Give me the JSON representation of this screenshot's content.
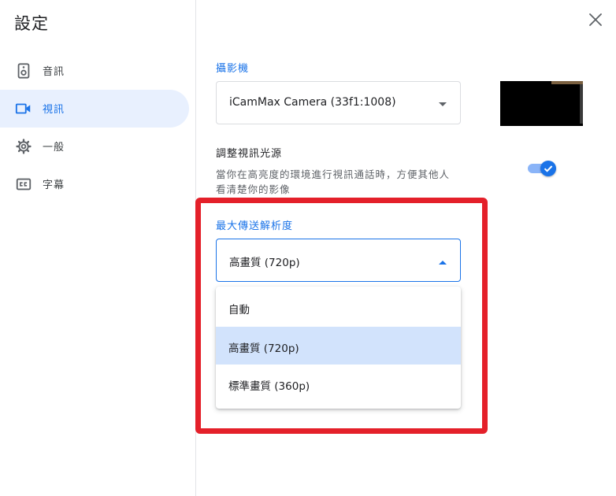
{
  "dialog": {
    "title": "設定",
    "close_icon": "close-icon"
  },
  "sidebar": {
    "items": [
      {
        "label": "音訊",
        "icon": "speaker-icon",
        "active": false
      },
      {
        "label": "視訊",
        "icon": "videocam-icon",
        "active": true
      },
      {
        "label": "一般",
        "icon": "gear-icon",
        "active": false
      },
      {
        "label": "字幕",
        "icon": "closed-caption-icon",
        "active": false
      }
    ]
  },
  "camera": {
    "label": "攝影機",
    "selected": "iCamMax Camera (33f1:1008)"
  },
  "light_adjust": {
    "title": "調整視訊光源",
    "description": "當你在高亮度的環境進行視訊通話時，方便其他人看清楚你的影像",
    "enabled": true
  },
  "resolution": {
    "label": "最大傳送解析度",
    "selected": "高畫質 (720p)",
    "options": [
      "自動",
      "高畫質 (720p)",
      "標準畫質 (360p)"
    ],
    "selected_index": 1
  },
  "colors": {
    "accent": "#1a73e8",
    "highlight_border": "#e4202a",
    "selected_option_bg": "#d2e3fc"
  }
}
